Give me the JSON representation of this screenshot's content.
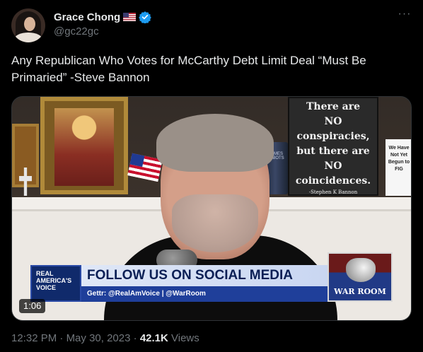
{
  "author": {
    "name": "Grace Chong",
    "flag_icon": "us-flag-icon",
    "verified_icon": "verified-badge-icon",
    "handle": "@gc22gc"
  },
  "more_label": "···",
  "tweet": {
    "text": "Any Republican Who Votes for McCarthy Debt Limit Deal “Must Be Primaried” -Steve Bannon"
  },
  "media": {
    "type": "video",
    "duration": "1:06",
    "sign_lines": [
      "There are",
      "NO",
      "conspiracies,",
      "but there are",
      "NO",
      "coincidences."
    ],
    "sign_signature": "-Stephen K Bannon",
    "small_sign": "We Have Not Yet Begun to FIG",
    "mug_text": "HOMES ROBOTS",
    "lower_third": {
      "network_logo": "REAL AMERICA'S VOICE",
      "headline": "FOLLOW US ON SOCIAL MEDIA",
      "subline": "Gettr: @RealAmVoice | @WarRoom",
      "show_logo": "WAR ROOM"
    }
  },
  "meta": {
    "time": "12:32 PM",
    "separator": "·",
    "date": "May 30, 2023",
    "views_count": "42.1K",
    "views_label": "Views"
  },
  "colors": {
    "background": "#000000",
    "text_primary": "#e7e9ea",
    "text_secondary": "#71767b",
    "verified_blue": "#1d9bf0"
  }
}
